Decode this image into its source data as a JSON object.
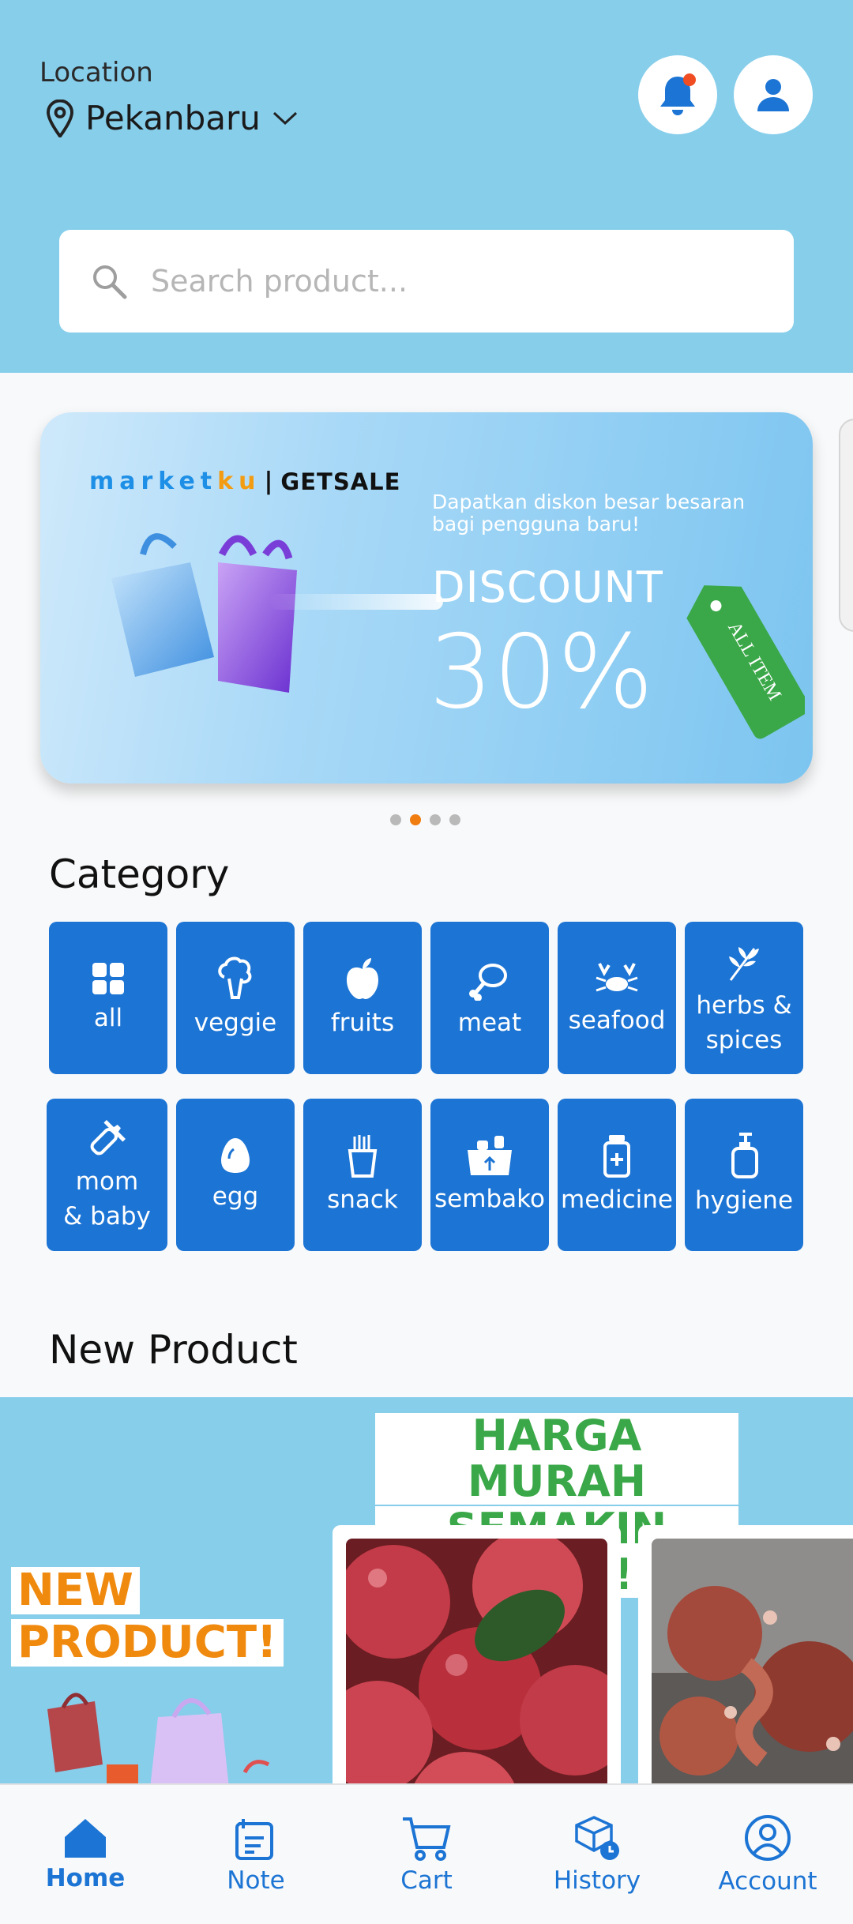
{
  "header": {
    "location_title": "Location",
    "location_value": "Pekanbaru",
    "search_placeholder": "Search product..."
  },
  "banner": {
    "brand_name_primary": "marketku",
    "brand_separator": "|",
    "brand_sale": "GETSALE",
    "promo_text": "Dapatkan diskon besar besaran bagi pengguna baru!",
    "discount_label": "DISCOUNT",
    "discount_value": "30%",
    "tag_text": "ALL ITEM",
    "slide_count": 4,
    "active_slide": 2
  },
  "category": {
    "title": "Category",
    "items": [
      {
        "label": "all",
        "icon": "grid-icon"
      },
      {
        "label": "veggie",
        "icon": "broccoli-icon"
      },
      {
        "label": "fruits",
        "icon": "apple-icon"
      },
      {
        "label": "meat",
        "icon": "meat-icon"
      },
      {
        "label": "seafood",
        "icon": "crab-icon"
      },
      {
        "label": "herbs &\nspices",
        "icon": "herbs-icon"
      },
      {
        "label": "mom\n& baby",
        "icon": "baby-bottle-icon"
      },
      {
        "label": "egg",
        "icon": "egg-icon"
      },
      {
        "label": "snack",
        "icon": "fries-icon"
      },
      {
        "label": "sembako",
        "icon": "basket-icon"
      },
      {
        "label": "medicine",
        "icon": "medicine-bottle-icon"
      },
      {
        "label": "hygiene",
        "icon": "soap-icon"
      }
    ]
  },
  "new_product": {
    "title": "New Product",
    "heading_line1": "HARGA MURAH",
    "heading_line2": "SEMAKIN WAH!!",
    "badge_line1": "NEW",
    "badge_line2": "PRODUCT!"
  },
  "nav": {
    "items": [
      {
        "label": "Home",
        "icon": "home-icon",
        "active": true
      },
      {
        "label": "Note",
        "icon": "note-icon",
        "active": false
      },
      {
        "label": "Cart",
        "icon": "cart-icon",
        "active": false
      },
      {
        "label": "History",
        "icon": "history-icon",
        "active": false
      },
      {
        "label": "Account",
        "icon": "account-icon",
        "active": false
      }
    ]
  },
  "colors": {
    "header_bg": "#87ceeb",
    "primary": "#1c74d4",
    "accent_orange": "#f07d10",
    "green": "#3aa848"
  }
}
